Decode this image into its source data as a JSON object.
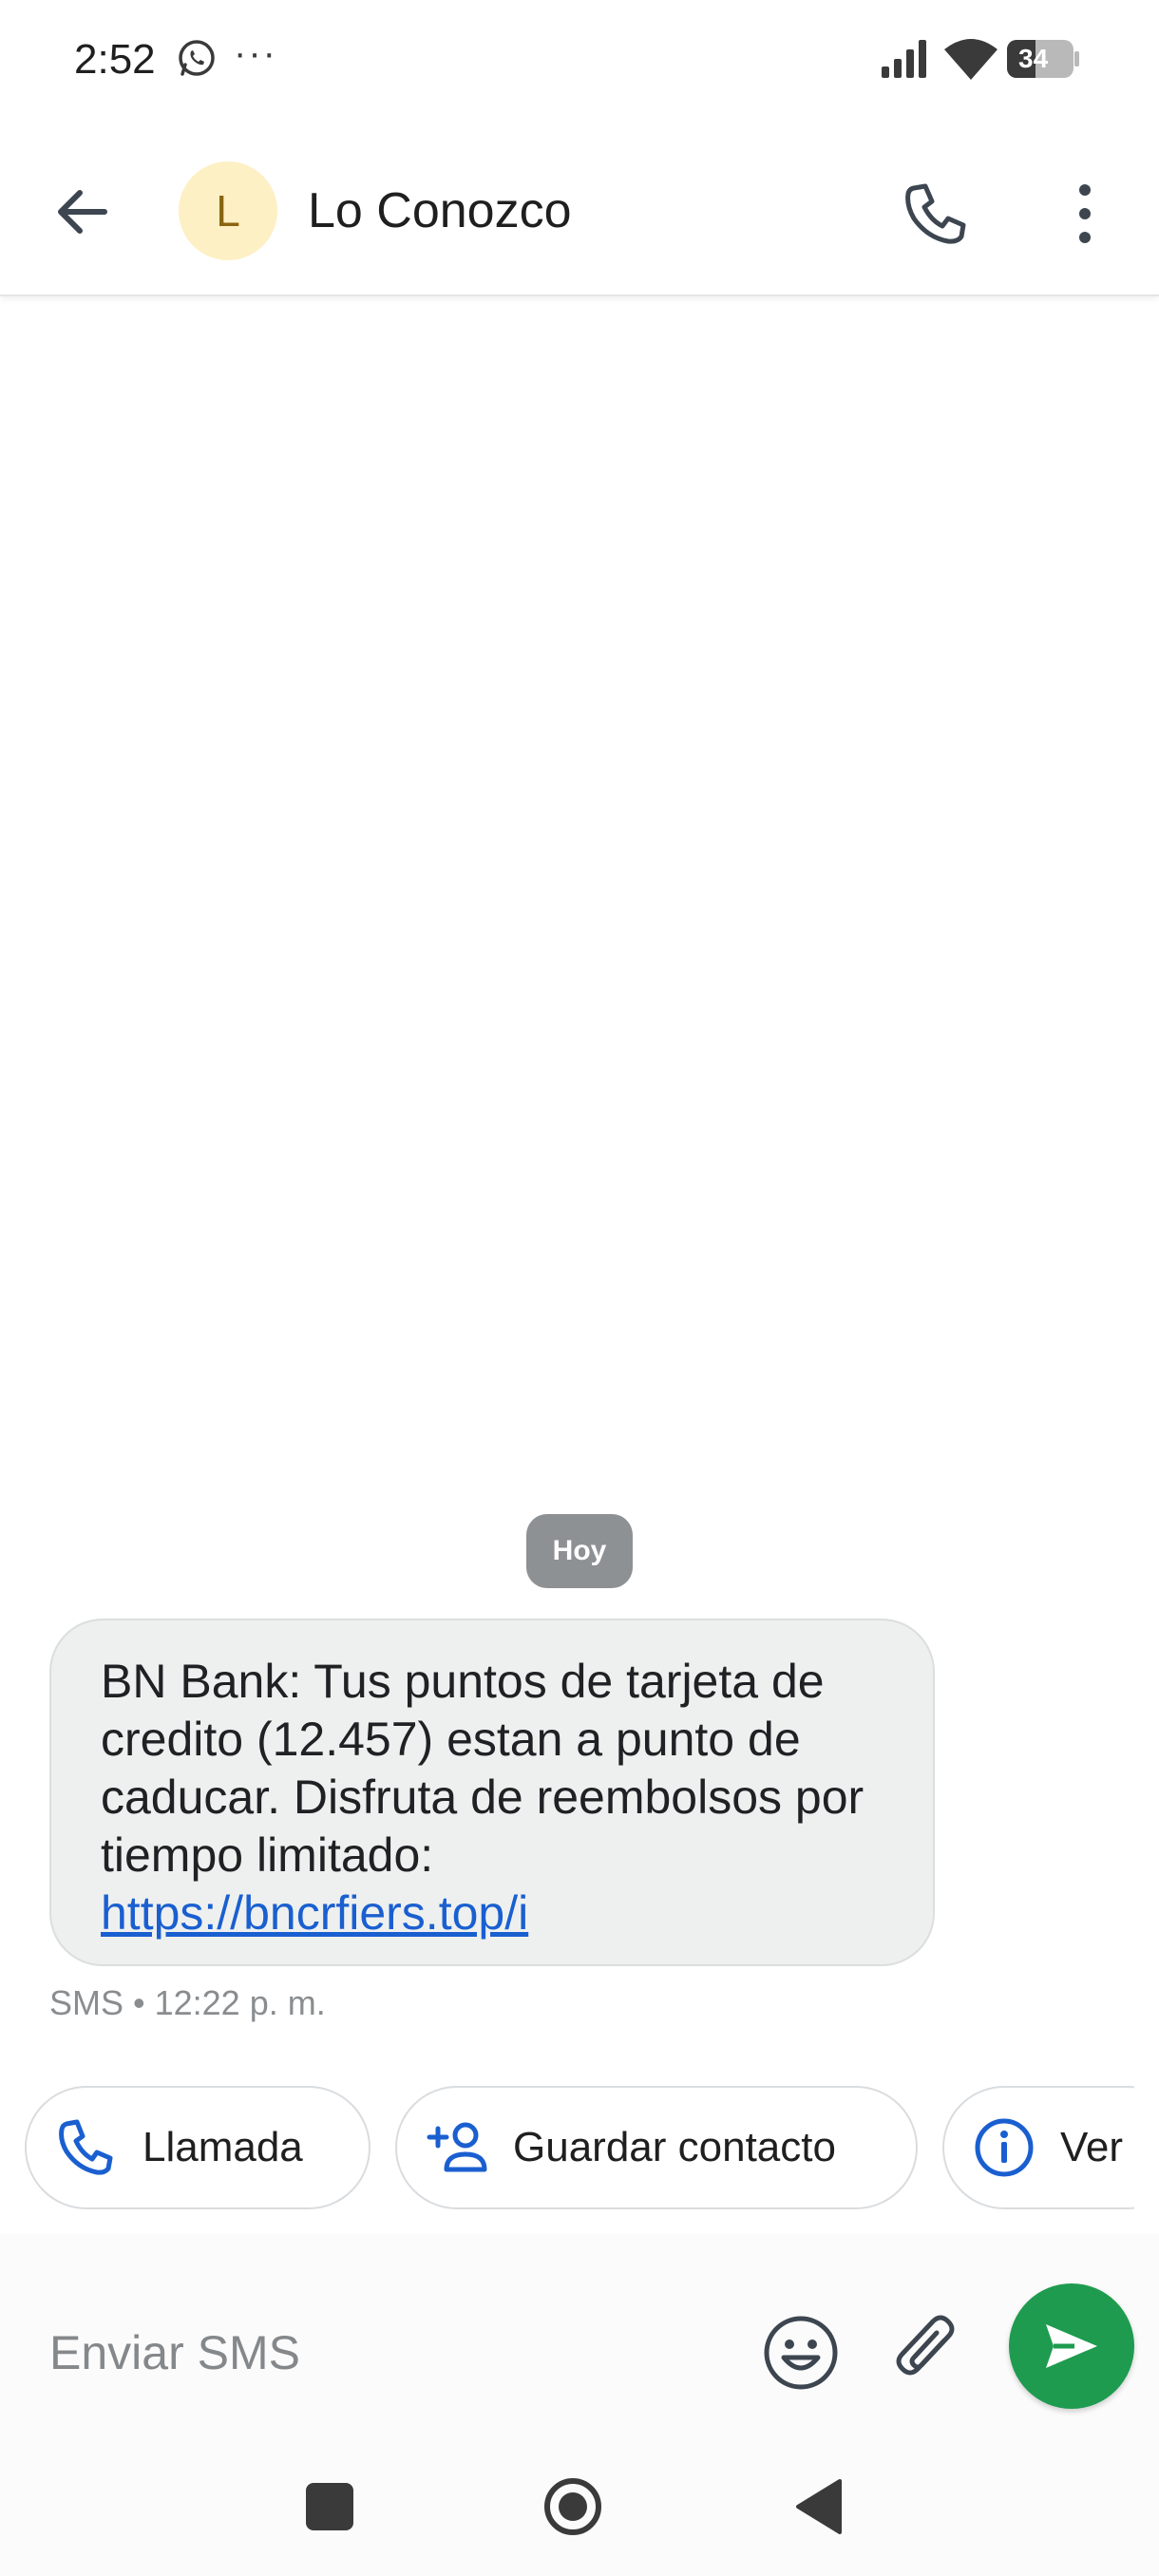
{
  "status_bar": {
    "time": "2:52",
    "notification_icons": [
      "whatsapp-icon",
      "more-dots-icon"
    ],
    "overflow_dots": "···",
    "battery": "34"
  },
  "app_bar": {
    "avatar_letter": "L",
    "contact_name": "Lo Conozco",
    "icons": [
      "back-arrow-icon",
      "phone-icon",
      "more-vert-icon"
    ]
  },
  "conversation": {
    "date_chip": "Hoy",
    "message": {
      "text": "BN Bank: Tus puntos de tarjeta de credito (12.457) estan a punto de caducar. Disfruta de reembolsos por tiempo limitado:",
      "link": "https://bncrfiers.top/i",
      "meta": "SMS • 12:22 p. m."
    }
  },
  "suggestions": {
    "call_label": "Llamada",
    "save_label": "Guardar contacto",
    "view_label": "Ver"
  },
  "compose": {
    "placeholder": "Enviar SMS",
    "icons": [
      "emoji-icon",
      "attach-icon",
      "send-icon"
    ]
  },
  "colors": {
    "accent_blue": "#1a5fd0",
    "send_green": "#1e9b4f",
    "avatar_bg": "#fdf0c4",
    "bubble_bg": "#eef0ef"
  }
}
